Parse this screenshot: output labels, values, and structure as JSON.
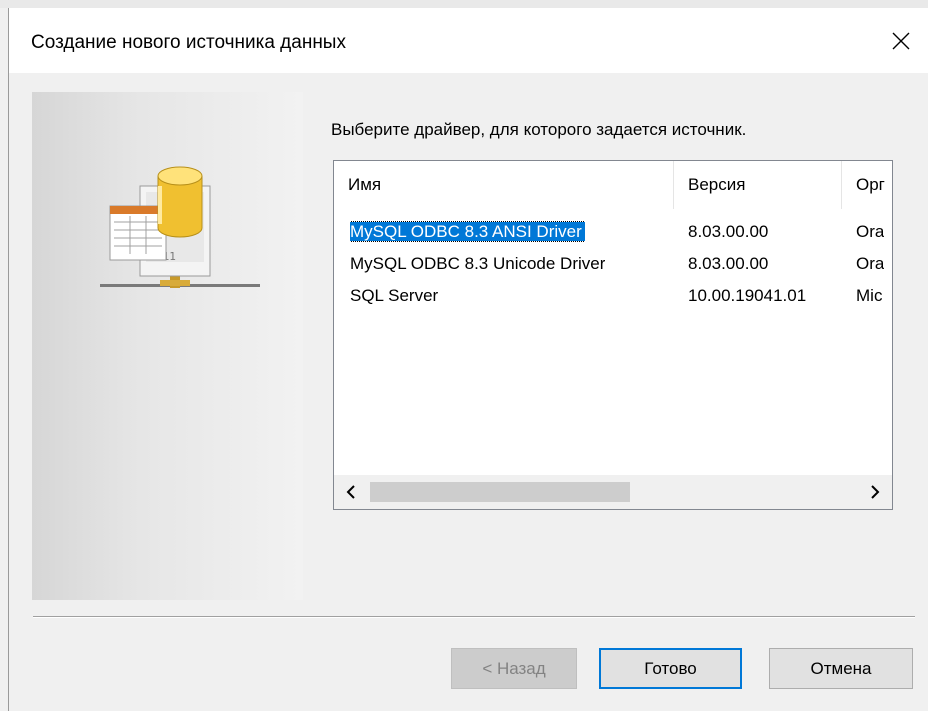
{
  "window": {
    "title": "Создание нового источника данных"
  },
  "instruction": "Выберите драйвер, для которого задается источник.",
  "list": {
    "columns": [
      "Имя",
      "Версия",
      "Орг"
    ],
    "rows": [
      {
        "name": "MySQL ODBC 8.3 ANSI Driver",
        "version": "8.03.00.00",
        "org": "Ora",
        "selected": true
      },
      {
        "name": "MySQL ODBC 8.3 Unicode Driver",
        "version": "8.03.00.00",
        "org": "Ora",
        "selected": false
      },
      {
        "name": "SQL Server",
        "version": "10.00.19041.01",
        "org": "Mic",
        "selected": false
      }
    ]
  },
  "buttons": {
    "back": "< Назад",
    "finish": "Готово",
    "cancel": "Отмена"
  },
  "icons": {
    "close": "close-icon",
    "scroll_left": "chevron-left-icon",
    "scroll_right": "chevron-right-icon",
    "illustration": "data-source-icon"
  },
  "colors": {
    "selection": "#0078d7",
    "default_button_border": "#0078d7"
  }
}
